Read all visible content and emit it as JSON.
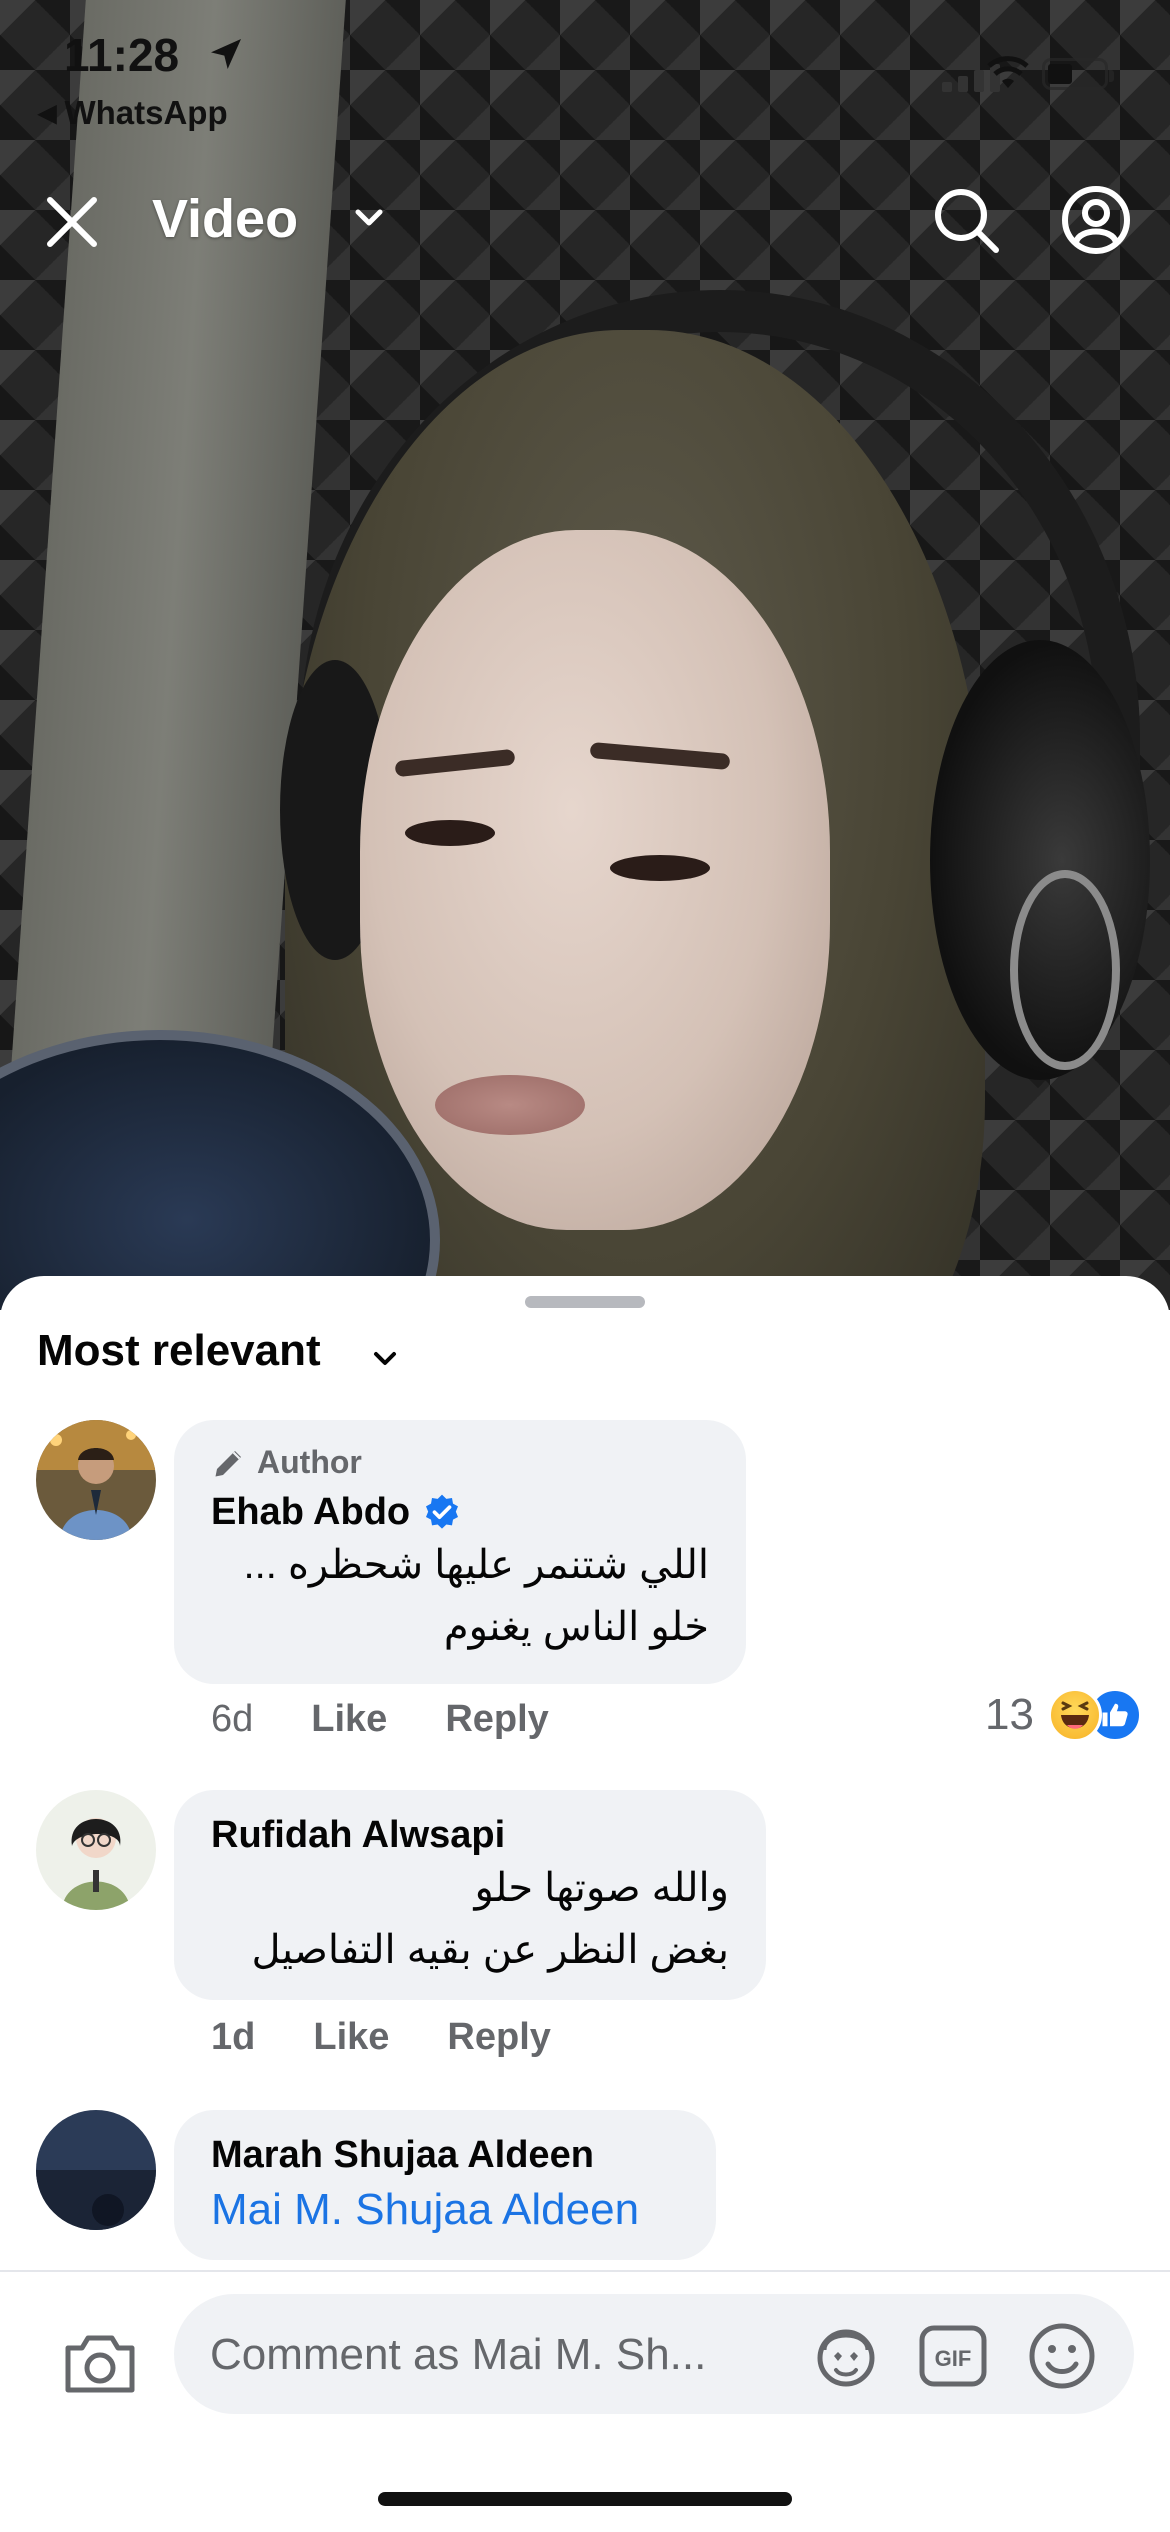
{
  "status_bar": {
    "time": "11:28",
    "back_app": "WhatsApp"
  },
  "header": {
    "title": "Video"
  },
  "comments_panel": {
    "sort_label": "Most relevant",
    "comments": [
      {
        "badge": "Author",
        "name": "Ehab Abdo",
        "verified": true,
        "text_line1": "اللي شتنمر عليها شحظره ...",
        "text_line2": "خلو الناس يغنوم",
        "time": "6d",
        "like_label": "Like",
        "reply_label": "Reply",
        "reaction_count": "13",
        "reactions": [
          "haha",
          "like"
        ]
      },
      {
        "name": "Rufidah Alwsapi",
        "text_line1": "والله صوتها حلو",
        "text_line2": "بغض النظر عن بقيه التفاصيل",
        "time": "1d",
        "like_label": "Like",
        "reply_label": "Reply"
      },
      {
        "name": "Marah Shujaa Aldeen",
        "mention": "Mai M. Shujaa Aldeen"
      }
    ]
  },
  "composer": {
    "placeholder": "Comment as Mai M. Sh..."
  },
  "colors": {
    "link_blue": "#1b74e4",
    "bubble_bg": "#f0f2f5",
    "secondary_text": "#65676b",
    "like_blue": "#1877f2"
  }
}
